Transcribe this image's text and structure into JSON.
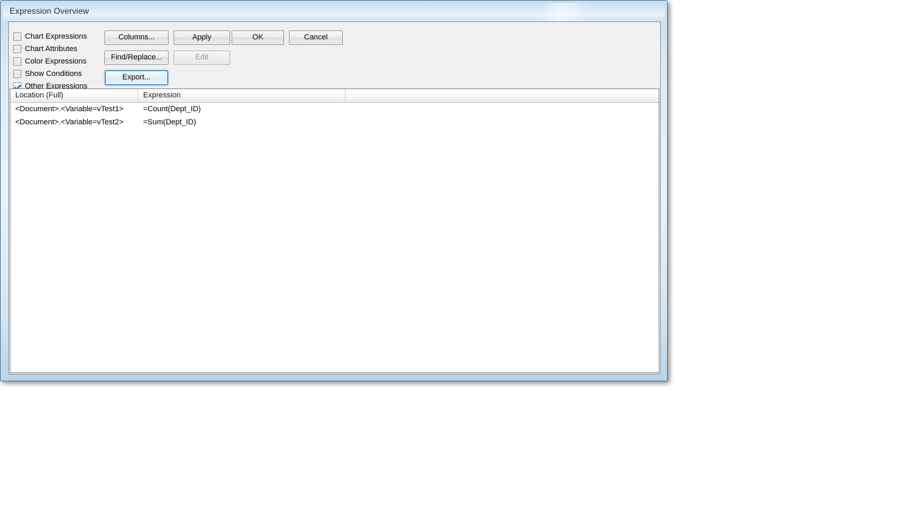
{
  "window": {
    "title": "Expression Overview"
  },
  "filters": [
    {
      "label": "Chart Expressions",
      "checked": false
    },
    {
      "label": "Chart Attributes",
      "checked": false
    },
    {
      "label": "Color Expressions",
      "checked": false
    },
    {
      "label": "Show Conditions",
      "checked": false
    },
    {
      "label": "Other Expressions",
      "checked": true
    }
  ],
  "buttons": {
    "columns": {
      "label": "Columns...",
      "disabled": false,
      "default": false
    },
    "apply": {
      "label": "Apply",
      "disabled": false,
      "default": false
    },
    "ok": {
      "label": "OK",
      "disabled": false,
      "default": false
    },
    "cancel": {
      "label": "Cancel",
      "disabled": false,
      "default": false
    },
    "find_replace": {
      "label": "Find/Replace...",
      "disabled": false,
      "default": false
    },
    "edit": {
      "label": "Edit",
      "disabled": true,
      "default": false
    },
    "export": {
      "label": "Export...",
      "disabled": false,
      "default": true
    }
  },
  "grid": {
    "columns": [
      "Location (Full)",
      "Expression",
      ""
    ],
    "rows": [
      {
        "location": "<Document>.<Variable=vTest1>",
        "expression": "=Count(Dept_ID)",
        "extra": ""
      },
      {
        "location": "<Document>.<Variable=vTest2>",
        "expression": "=Sum(Dept_ID)",
        "extra": ""
      }
    ]
  },
  "colors": {
    "title_bar_blue": "#dcebf8",
    "panel_gray": "#f0f0f0",
    "default_button_border": "#3c7fb1",
    "checkmark_blue": "#1e5fa8",
    "grid_background": "#ffffff"
  }
}
